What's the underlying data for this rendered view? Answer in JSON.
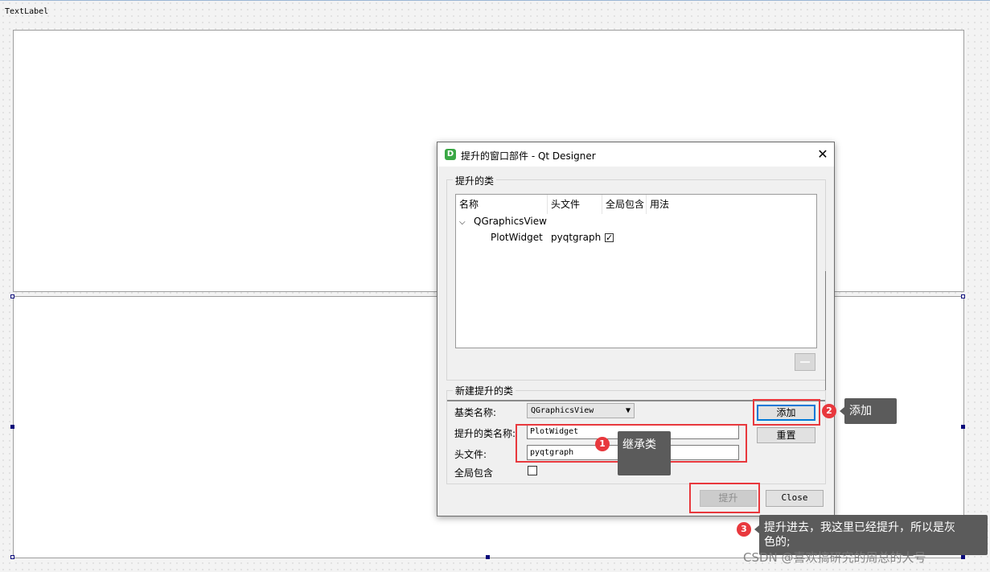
{
  "form": {
    "text_label": "TextLabel"
  },
  "dialog": {
    "app_icon_letter": "D",
    "title": "提升的窗口部件 - Qt Designer",
    "close_glyph": "✕",
    "promoted_group_title": "提升的类",
    "columns": [
      "名称",
      "头文件",
      "全局包含",
      "用法"
    ],
    "tree": {
      "parent_class": "QGraphicsView",
      "child": {
        "name": "PlotWidget",
        "header": "pyqtgraph",
        "global_include_checked": true
      }
    },
    "new_group_title": "新建提升的类",
    "base_class_label": "基类名称:",
    "base_class_value": "QGraphicsView",
    "promoted_name_label": "提升的类名称:",
    "promoted_name_value": "PlotWidget",
    "header_label": "头文件:",
    "header_value": "pyqtgraph",
    "global_include_label": "全局包含",
    "global_include_checked": false,
    "add_button": "添加",
    "reset_button": "重置",
    "promote_button": "提升",
    "close_button": "Close"
  },
  "annotations": {
    "badge1": "1",
    "tip1": "继承类",
    "badge2": "2",
    "tip2": "添加",
    "badge3": "3",
    "tip3_line1": "提升进去，我这里已经提升，所以是灰",
    "tip3_line2": "色的;"
  },
  "watermark": "CSDN @喜欢搞研究的周总的大号",
  "colors": {
    "annotation_red": "#e8383d",
    "tooltip_gray": "#5b5b5b",
    "app_icon_green": "#3aa845",
    "focus_blue": "#0078d7"
  }
}
